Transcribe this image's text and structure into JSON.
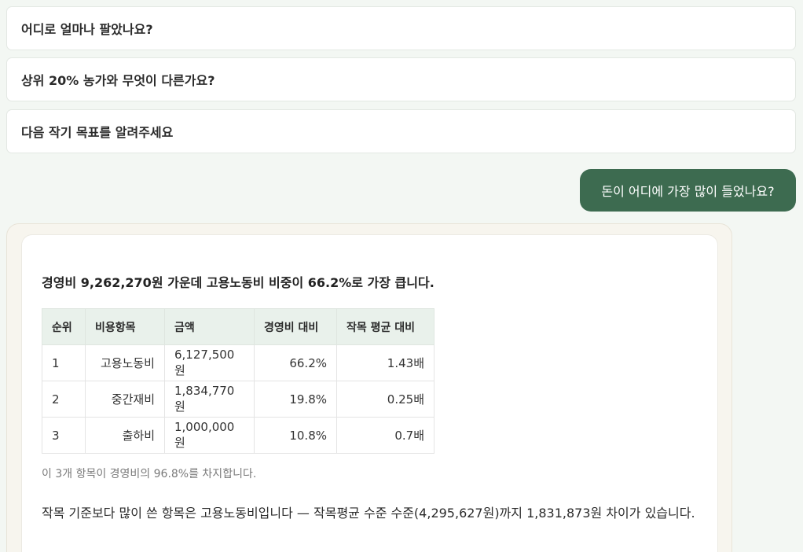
{
  "suggestions": [
    "어디로 얼마나 팔았나요?",
    "상위 20% 농가와 무엇이 다른가요?",
    "다음 작기 목표를 알려주세요"
  ],
  "user_message": "돈이 어디에 가장 많이 들었나요?",
  "answer": {
    "headline": "경영비 9,262,270원 가운데 고용노동비 비중이 66.2%로 가장 큽니다.",
    "table": {
      "headers": [
        "순위",
        "비용항목",
        "금액",
        "경영비 대비",
        "작목 평균 대비"
      ],
      "rows": [
        [
          "1",
          "고용노동비",
          "6,127,500원",
          "66.2%",
          "1.43배"
        ],
        [
          "2",
          "중간재비",
          "1,834,770원",
          "19.8%",
          "0.25배"
        ],
        [
          "3",
          "출하비",
          "1,000,000원",
          "10.8%",
          "0.7배"
        ]
      ]
    },
    "note": "이 3개 항목이 경영비의 96.8%를 차지합니다.",
    "paragraph": "작목 기준보다 많이 쓴 항목은 고용노동비입니다 — 작목평균 수준 수준(4,295,627원)까지 1,831,873원 차이가 있습니다."
  }
}
